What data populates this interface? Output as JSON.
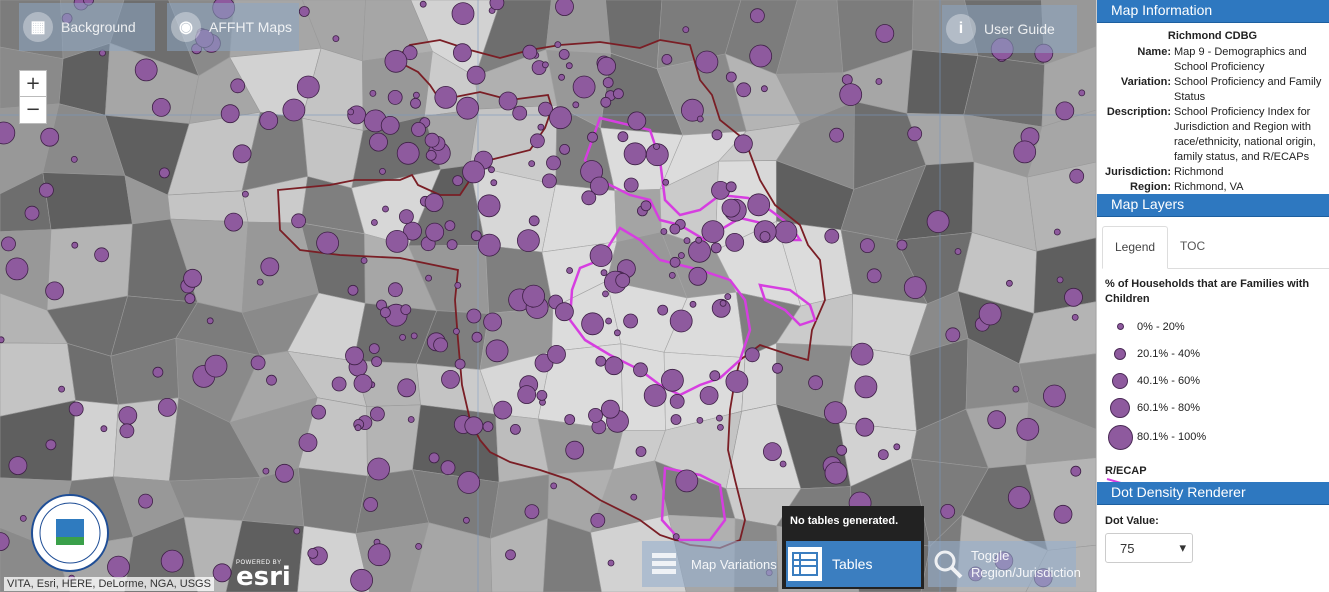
{
  "toolbar": {
    "background_label": "Background",
    "affht_label": "AFFHT Maps",
    "user_guide_label": "User Guide",
    "zoom_in": "+",
    "zoom_out": "−"
  },
  "map": {
    "attribution": "VITA, Esri, HERE, DeLorme, NGA, USGS",
    "powered_by": "POWERED BY",
    "esri_logo": "esri",
    "seal_icon": "hud-seal-icon",
    "dot_color": "#8e5a9e",
    "recap_color": "#d63ee0",
    "jurisdiction_color": "#7a1e25"
  },
  "bottom_buttons": {
    "map_variations": "Map Variations",
    "tables": "Tables",
    "tables_message": "No tables generated.",
    "toggle_line1": "Toggle",
    "toggle_line2": "Region/Jurisdiction"
  },
  "map_information": {
    "header": "Map Information",
    "title": "Richmond CDBG",
    "rows": [
      {
        "key": "Name:",
        "value": "Map 9 - Demographics and School Proficiency"
      },
      {
        "key": "Variation:",
        "value": "School Proficiency and Family Status"
      },
      {
        "key": "Description:",
        "value": "School Proficiency Index for Jurisdiction and Region with race/ethnicity, national origin, family status, and R/ECAPs"
      },
      {
        "key": "Jurisdiction:",
        "value": "Richmond"
      },
      {
        "key": "Region:",
        "value": "Richmond, VA"
      }
    ]
  },
  "map_layers": {
    "header": "Map Layers",
    "tabs": [
      "Legend",
      "TOC"
    ],
    "legend_title": "% of Households that are Families with Children",
    "legend_items": [
      {
        "label": "0% - 20%",
        "size": 5
      },
      {
        "label": "20.1% - 40%",
        "size": 10
      },
      {
        "label": "40.1% - 60%",
        "size": 14
      },
      {
        "label": "60.1% - 80%",
        "size": 18
      },
      {
        "label": "80.1% - 100%",
        "size": 23
      }
    ],
    "recap_label": "R/ECAP"
  },
  "dot_density": {
    "header": "Dot Density Renderer",
    "dot_value_label": "Dot Value:",
    "dot_value": "75"
  }
}
